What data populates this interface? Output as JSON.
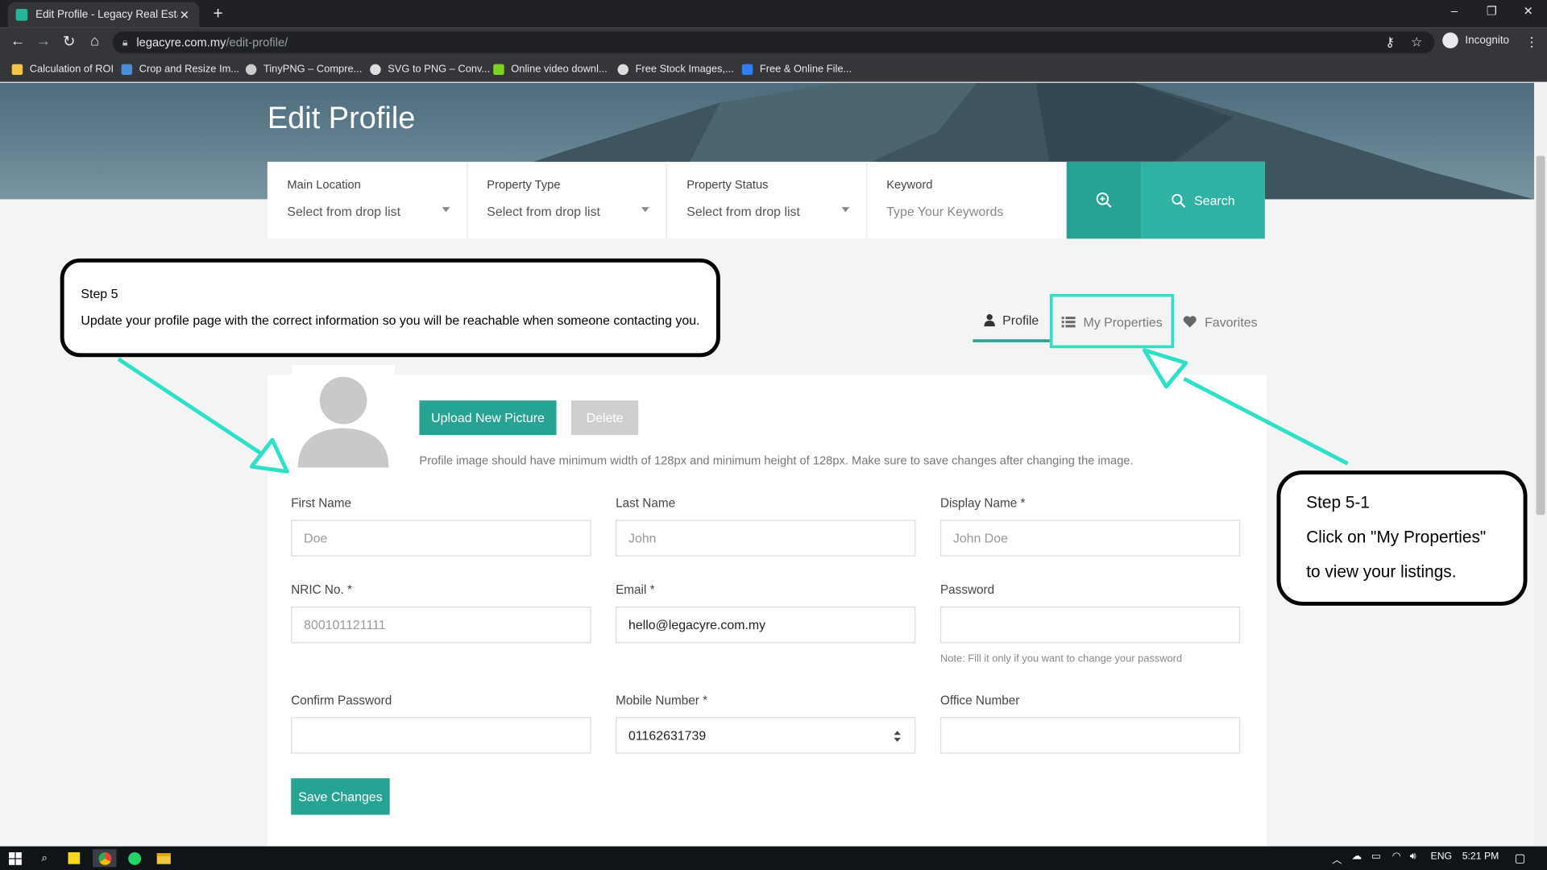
{
  "browser": {
    "tab_title": "Edit Profile - Legacy Real Estate",
    "tab_close": "✕",
    "new_tab": "+",
    "url_host": "legacyre.com.my",
    "url_path": "/edit-profile/",
    "incognito_label": "Incognito",
    "controls": [
      "–",
      "❐",
      "✕"
    ],
    "bookmarks": [
      {
        "label": "Calculation of ROI",
        "color": "#f4c542"
      },
      {
        "label": "Crop and Resize Im...",
        "color": "#4a90d9"
      },
      {
        "label": "TinyPNG – Compre...",
        "color": "#cccccc"
      },
      {
        "label": "SVG to PNG – Conv...",
        "color": "#dddddd"
      },
      {
        "label": "Online video downl...",
        "color": "#7ed321"
      },
      {
        "label": "Free Stock Images,...",
        "color": "#dddddd"
      },
      {
        "label": "Free & Online File...",
        "color": "#2d7ff9"
      }
    ]
  },
  "page": {
    "title": "Edit Profile",
    "search": {
      "fields": [
        {
          "label": "Main Location",
          "value": "Select from drop list"
        },
        {
          "label": "Property Type",
          "value": "Select from drop list"
        },
        {
          "label": "Property Status",
          "value": "Select from drop list"
        },
        {
          "label": "Keyword",
          "value": "Type Your Keywords"
        }
      ],
      "button_label": "Search"
    },
    "tabs": [
      {
        "label": "Profile",
        "icon": "user-icon",
        "active": true
      },
      {
        "label": "My Properties",
        "icon": "list-icon"
      },
      {
        "label": "Favorites",
        "icon": "heart-icon"
      }
    ],
    "upload_label": "Upload New Picture",
    "delete_label": "Delete",
    "image_note": "Profile image should have minimum width of 128px and minimum height of 128px. Make sure to save changes after changing the image.",
    "form": {
      "first_name": {
        "label": "First Name",
        "placeholder": "Doe"
      },
      "last_name": {
        "label": "Last Name",
        "placeholder": "John"
      },
      "display_name": {
        "label": "Display Name *",
        "placeholder": "John Doe"
      },
      "nric": {
        "label": "NRIC No. *",
        "placeholder": "800101121111"
      },
      "email": {
        "label": "Email *",
        "value": "hello@legacyre.com.my"
      },
      "password": {
        "label": "Password",
        "value": "",
        "hint": "Note: Fill it only if you want to change your password"
      },
      "confirm_password": {
        "label": "Confirm Password",
        "value": ""
      },
      "mobile": {
        "label": "Mobile Number *",
        "value": "01162631739"
      },
      "office": {
        "label": "Office Number",
        "value": ""
      }
    },
    "save_label": "Save Changes"
  },
  "callouts": {
    "step5": {
      "title": "Step 5",
      "text": "Update your profile page with the correct information so you will be reachable when someone contacting you."
    },
    "step51": {
      "title": "Step 5-1",
      "line1": "Click on \"My Properties\"",
      "line2": "to view your listings."
    }
  },
  "taskbar": {
    "language": "ENG",
    "time": "5:21 PM"
  },
  "colors": {
    "accent": "#27a394",
    "highlight": "#2fe0c8"
  }
}
